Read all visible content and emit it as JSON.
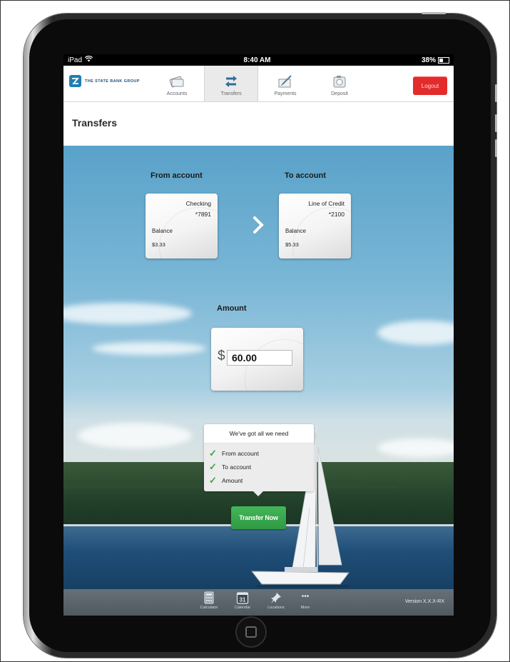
{
  "status_bar": {
    "device": "iPad",
    "time": "8:40 AM",
    "battery": "38%"
  },
  "brand": {
    "name": "THE STATE BANK GROUP",
    "color": "#1f7fb4"
  },
  "nav": {
    "tabs": [
      {
        "label": "Accounts",
        "icon": "card-icon"
      },
      {
        "label": "Transfers",
        "icon": "transfer-arrows-icon",
        "active": true
      },
      {
        "label": "Payments",
        "icon": "payment-icon"
      },
      {
        "label": "Deposit",
        "icon": "camera-icon"
      }
    ],
    "logout_label": "Logout"
  },
  "page": {
    "title": "Transfers"
  },
  "from_account": {
    "heading": "From account",
    "name": "Checking",
    "number": "*7891",
    "balance_label": "Balance",
    "balance_value": "$3.33"
  },
  "to_account": {
    "heading": "To account",
    "name": "Line of Credit",
    "number": "*2100",
    "balance_label": "Balance",
    "balance_value": "$5.33"
  },
  "amount": {
    "heading": "Amount",
    "currency": "$",
    "value": "60.00"
  },
  "checklist": {
    "title": "We've got all we need",
    "items": [
      "From account",
      "To account",
      "Amount"
    ]
  },
  "transfer_button_label": "Transfer Now",
  "bottom_bar": {
    "items": [
      {
        "label": "Calculator",
        "icon": "calculator-icon"
      },
      {
        "label": "Calendar",
        "icon": "calendar-icon",
        "badge": "31"
      },
      {
        "label": "Locations",
        "icon": "pushpin-icon"
      },
      {
        "label": "More",
        "icon": "more-dots-icon",
        "glyph": "•••"
      }
    ],
    "version": "Version X.X.X-RX"
  },
  "colors": {
    "logout": "#e32b2b",
    "transfer_button": "#3aa54b",
    "check": "#3aa54b"
  }
}
